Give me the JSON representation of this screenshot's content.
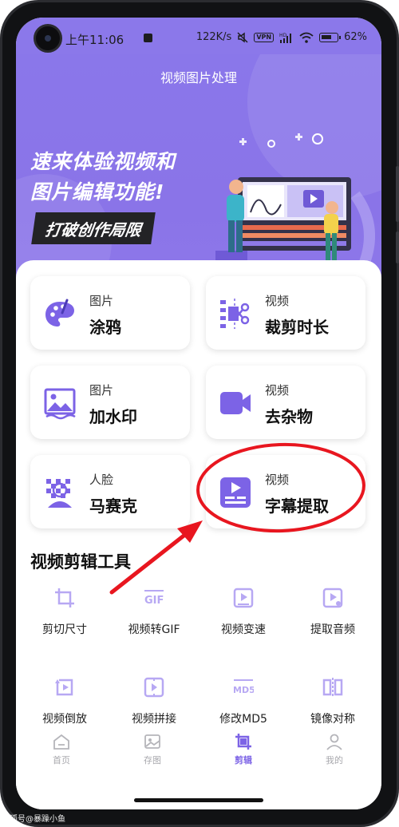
{
  "status_bar": {
    "time": "上午11:06",
    "speed": "122K/s",
    "vpn": "VPN",
    "hd": "HD",
    "battery": "62%"
  },
  "header": {
    "title": "视频图片处理",
    "promo_line1": "速来体验视频和",
    "promo_line2": "图片编辑功能!",
    "promo_button": "打破创作局限"
  },
  "cards": [
    {
      "category": "图片",
      "name": "涂鸦",
      "icon": "palette-icon"
    },
    {
      "category": "视频",
      "name": "裁剪时长",
      "icon": "scissors-icon"
    },
    {
      "category": "图片",
      "name": "加水印",
      "icon": "image-icon"
    },
    {
      "category": "视频",
      "name": "去杂物",
      "icon": "video-camera-icon"
    },
    {
      "category": "人脸",
      "name": "马赛克",
      "icon": "mosaic-face-icon"
    },
    {
      "category": "视频",
      "name": "字幕提取",
      "icon": "subtitle-icon"
    }
  ],
  "tools_section": {
    "title": "视频剪辑工具",
    "tools": [
      {
        "label": "剪切尺寸",
        "icon": "crop-icon"
      },
      {
        "label": "视频转GIF",
        "icon": "gif-icon"
      },
      {
        "label": "视频变速",
        "icon": "speed-icon"
      },
      {
        "label": "提取音频",
        "icon": "audio-extract-icon"
      },
      {
        "label": "视频倒放",
        "icon": "reverse-icon"
      },
      {
        "label": "视频拼接",
        "icon": "merge-icon"
      },
      {
        "label": "修改MD5",
        "icon": "md5-icon"
      },
      {
        "label": "镜像对称",
        "icon": "mirror-icon"
      }
    ]
  },
  "tab_bar": {
    "tabs": [
      {
        "label": "首页",
        "icon": "home-icon",
        "active": false
      },
      {
        "label": "存图",
        "icon": "gallery-icon",
        "active": false
      },
      {
        "label": "剪辑",
        "icon": "edit-crop-icon",
        "active": true
      },
      {
        "label": "我的",
        "icon": "profile-icon",
        "active": false
      }
    ]
  },
  "watermark": "搜狐号@暴躁小鱼",
  "colors": {
    "brand": "#8b78ea",
    "icon_purple": "#7c63e6",
    "tool_icon": "#b7a8f3",
    "annotation_red": "#e8161f"
  }
}
